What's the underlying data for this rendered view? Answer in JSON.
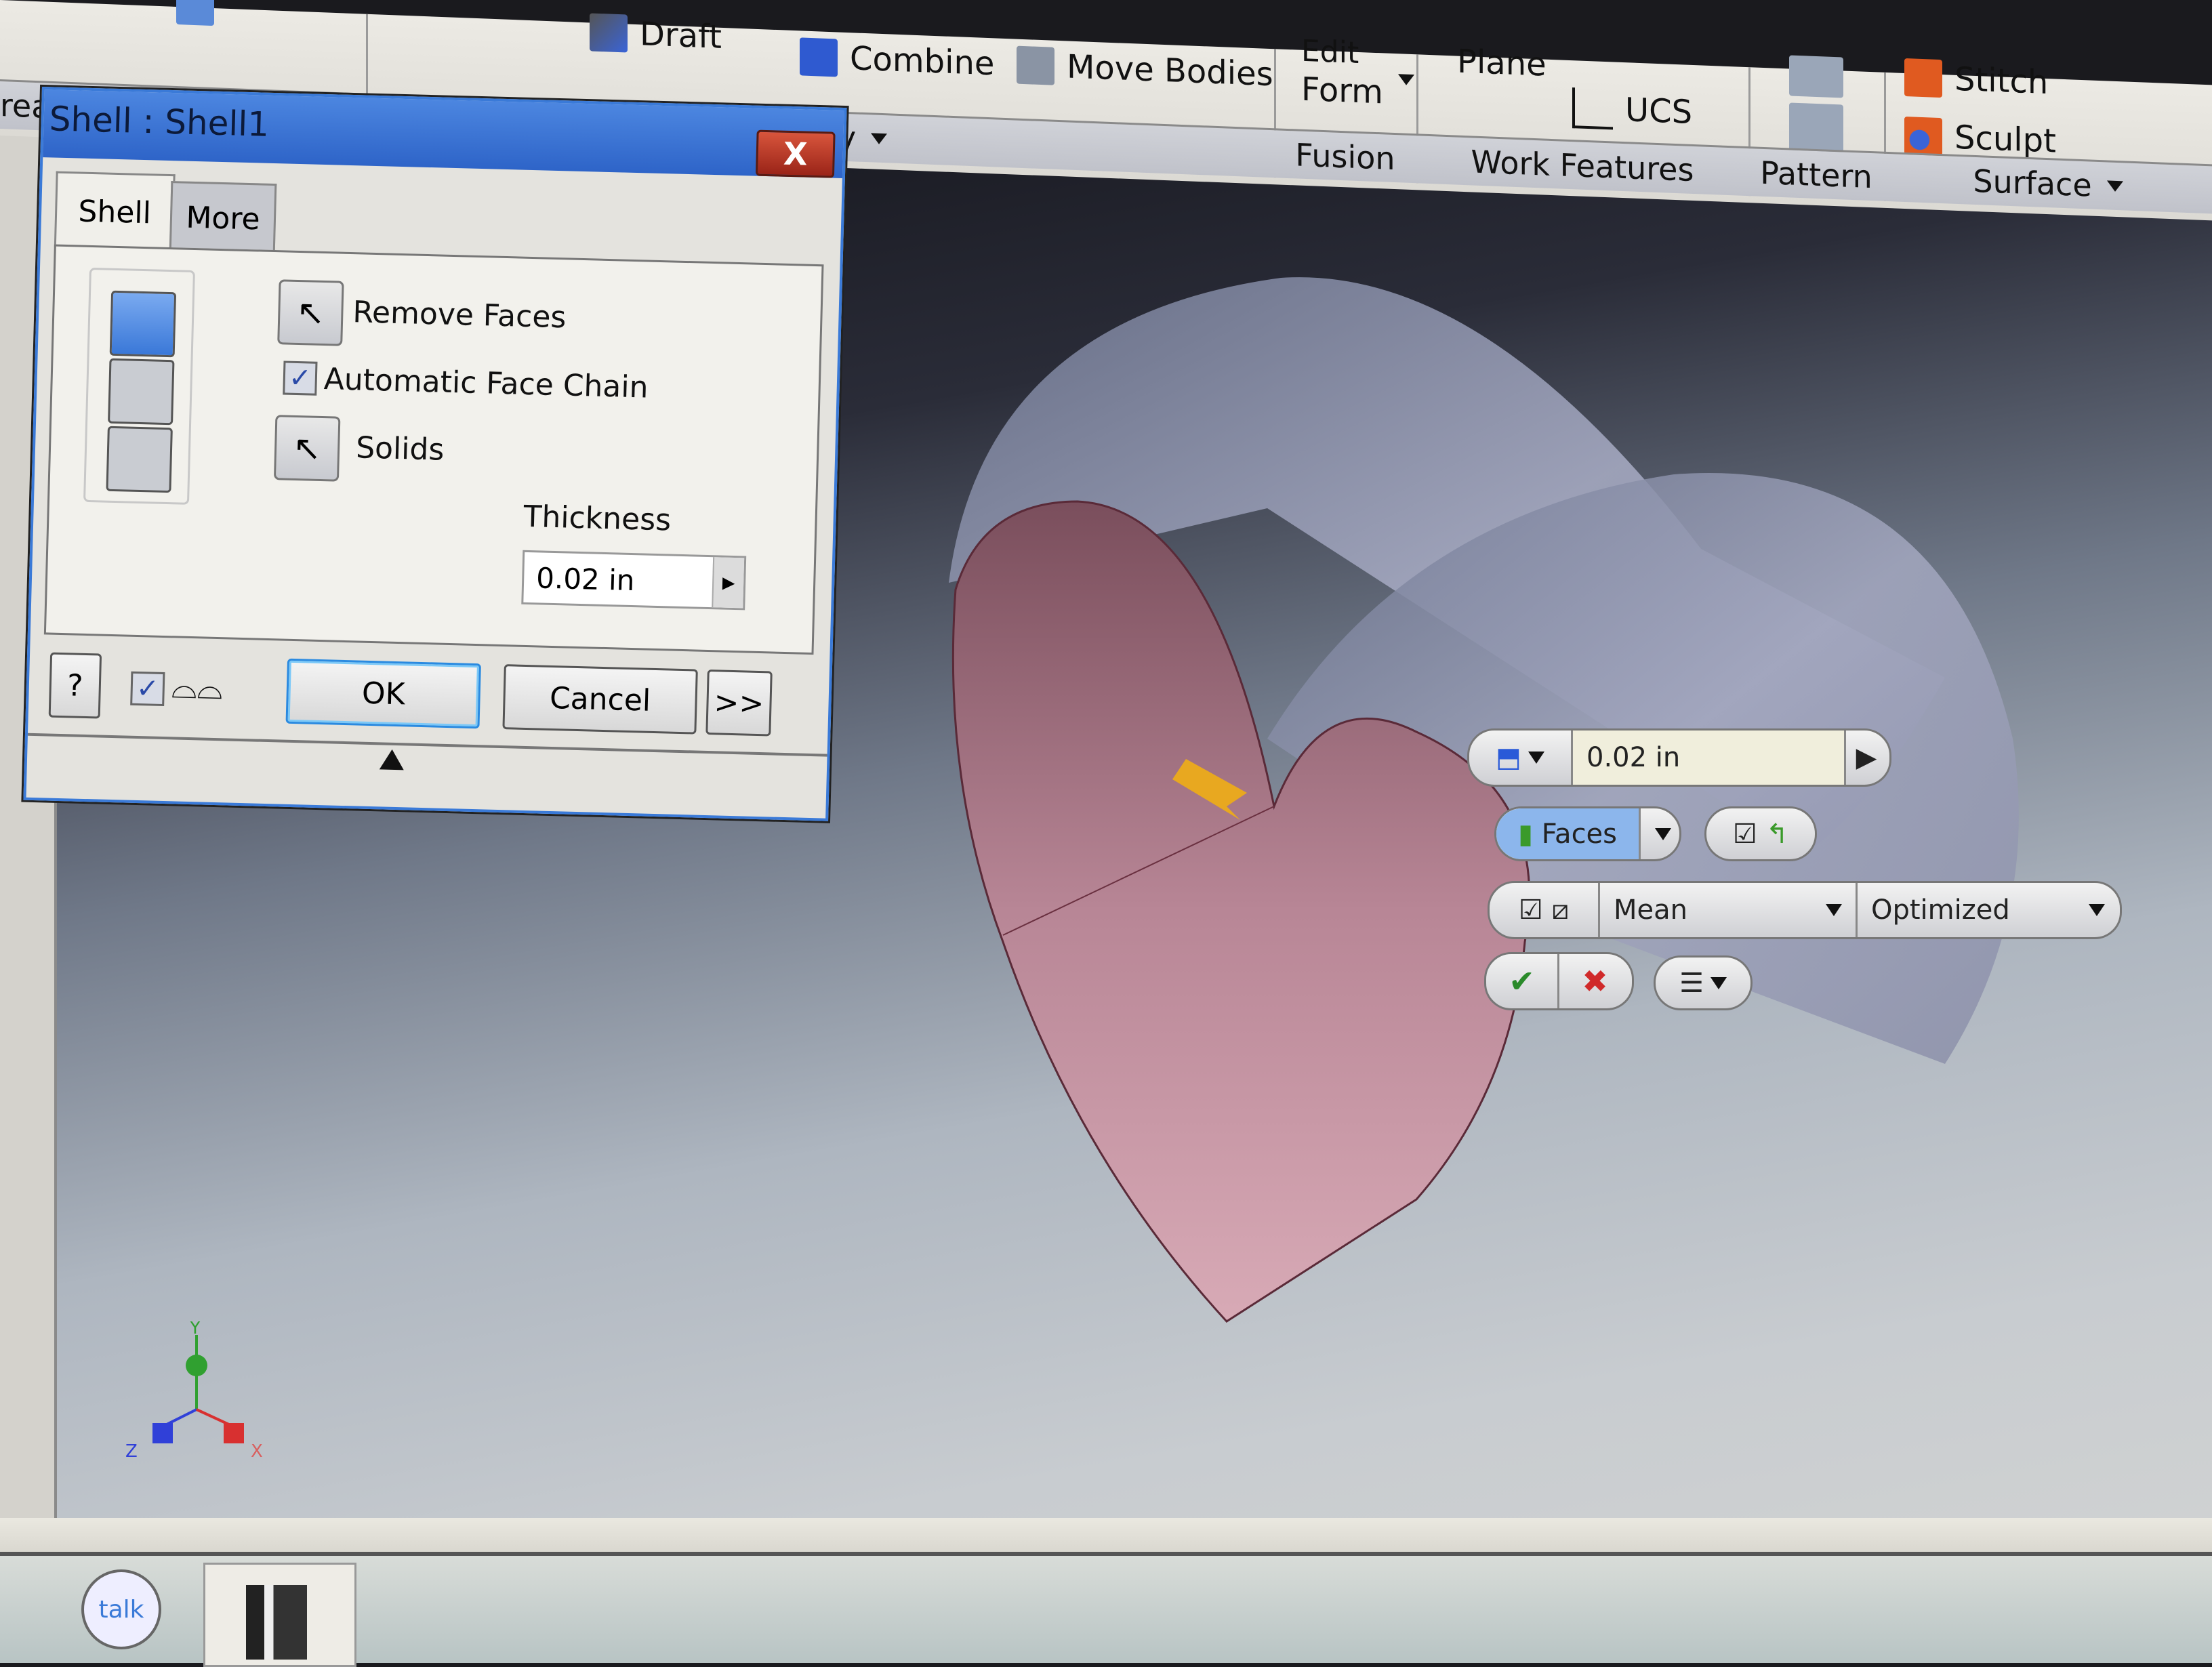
{
  "ribbon": {
    "panels": [
      {
        "label": "reate",
        "items": []
      },
      {
        "label": "Modify",
        "items": [
          "Draft",
          "Combine",
          "Move Bodies"
        ]
      },
      {
        "label": "Fusion",
        "items": [
          "Edit Form"
        ]
      },
      {
        "label": "Work Features",
        "items": [
          "Plane",
          "UCS"
        ]
      },
      {
        "label": "Pattern",
        "items": []
      },
      {
        "label": "Surface",
        "items": [
          "Stitch",
          "Sculpt"
        ]
      }
    ],
    "create_label": "reate",
    "modify_label": "Modify",
    "fusion_label": "Fusion",
    "work_features_label": "Work Features",
    "pattern_label": "Pattern",
    "surface_label": "Surface",
    "draft": "Draft",
    "combine": "Combine",
    "move_bodies": "Move Bodies",
    "edit_form_top": "Edit",
    "edit_form": "Form",
    "plane": "Plane",
    "ucs": "UCS",
    "stitch": "Stitch",
    "sculpt": "Sculpt"
  },
  "dialog": {
    "title": "Shell : Shell1",
    "close": "X",
    "tabs": [
      "Shell",
      "More"
    ],
    "remove_faces": "Remove Faces",
    "automatic_face_chain": "Automatic Face Chain",
    "automatic_face_chain_checked": true,
    "solids": "Solids",
    "thickness_label": "Thickness",
    "thickness_value": "0.02 in",
    "ok": "OK",
    "cancel": "Cancel",
    "more": ">>",
    "help": "?",
    "preview_checked": true
  },
  "mini_toolbar": {
    "thickness_value": "0.02 in",
    "faces_label": "Faces",
    "mean_value": "Mean",
    "optimized_value": "Optimized",
    "ok_glyph": "✔",
    "cancel_glyph": "✖"
  },
  "triad": {
    "x": "X",
    "y": "Y",
    "z": "Z"
  },
  "taskbar": {
    "talk": "talk"
  },
  "colors": {
    "dialog_title": "#3a74d8",
    "close_button": "#c03a26",
    "heart_face": "#c89aa8",
    "cylinder": "#9ea4bc",
    "arrow": "#e8a820",
    "x_axis": "#d83030",
    "y_axis": "#30a030",
    "z_axis": "#3040d8"
  }
}
